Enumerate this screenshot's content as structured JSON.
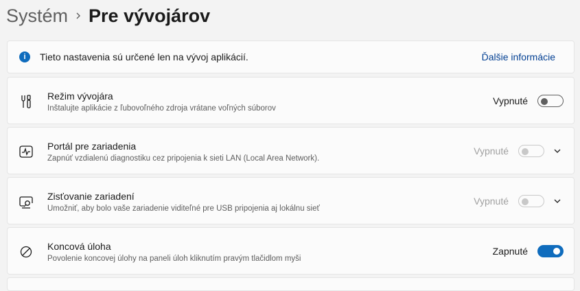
{
  "breadcrumb": {
    "parent": "Systém",
    "current": "Pre vývojárov"
  },
  "info": {
    "text": "Tieto nastavenia sú určené len na vývoj aplikácií.",
    "link": "Ďalšie informácie",
    "icon": "info-icon"
  },
  "settings": [
    {
      "title": "Režim vývojára",
      "description": "Inštalujte aplikácie z ľubovoľného zdroja vrátane voľných súborov",
      "state_label": "Vypnuté",
      "on": false,
      "enabled": true,
      "expandable": false,
      "icon": "developer-tools-icon"
    },
    {
      "title": "Portál pre zariadenia",
      "description": "Zapnúť vzdialenú diagnostiku cez pripojenia k sieti LAN (Local Area Network).",
      "state_label": "Vypnuté",
      "on": false,
      "enabled": false,
      "expandable": true,
      "icon": "pulse-monitor-icon"
    },
    {
      "title": "Zisťovanie zariadení",
      "description": "Umožniť, aby bolo vaše zariadenie viditeľné pre USB pripojenia aj lokálnu sieť",
      "state_label": "Vypnuté",
      "on": false,
      "enabled": false,
      "expandable": true,
      "icon": "device-search-icon"
    },
    {
      "title": "Koncová úloha",
      "description": "Povolenie koncovej úlohy na paneli úloh kliknutím pravým tlačidlom myši",
      "state_label": "Zapnuté",
      "on": true,
      "enabled": true,
      "expandable": false,
      "icon": "block-icon"
    }
  ],
  "colors": {
    "accent": "#0f6cbd",
    "link": "#003e92",
    "background": "#f3f3f3",
    "card": "#fbfbfb"
  }
}
